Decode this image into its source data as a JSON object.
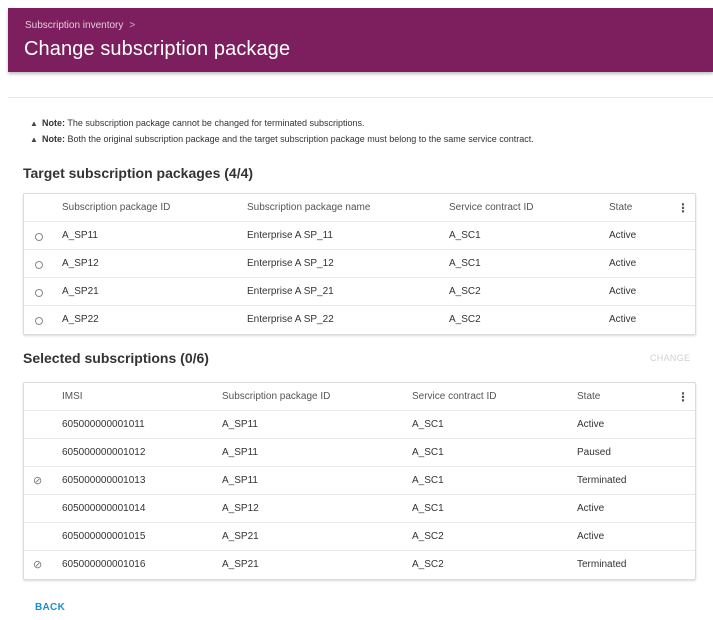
{
  "header": {
    "breadcrumb": "Subscription inventory",
    "breadcrumb_separator": ">",
    "title": "Change subscription package",
    "color": "#7d1f5e"
  },
  "notes": [
    {
      "prefix": "Note:",
      "text": "The subscription package cannot be changed for terminated subscriptions."
    },
    {
      "prefix": "Note:",
      "text": "Both the original subscription package and the target subscription package must belong to the same service contract."
    }
  ],
  "target_packages": {
    "title": "Target subscription packages (4/4)",
    "columns": [
      "Subscription package ID",
      "Subscription package name",
      "Service contract ID",
      "State"
    ],
    "rows": [
      [
        "A_SP11",
        "Enterprise A SP_11",
        "A_SC1",
        "Active"
      ],
      [
        "A_SP12",
        "Enterprise A SP_12",
        "A_SC1",
        "Active"
      ],
      [
        "A_SP21",
        "Enterprise A SP_21",
        "A_SC2",
        "Active"
      ],
      [
        "A_SP22",
        "Enterprise A SP_22",
        "A_SC2",
        "Active"
      ]
    ]
  },
  "selected_subscriptions": {
    "title": "Selected subscriptions (0/6)",
    "change_label": "CHANGE",
    "columns": [
      "IMSI",
      "Subscription package ID",
      "Service contract ID",
      "State"
    ],
    "rows": [
      [
        "605000000001011",
        "A_SP11",
        "A_SC1",
        "Active"
      ],
      [
        "605000000001012",
        "A_SP11",
        "A_SC1",
        "Paused"
      ],
      [
        "605000000001013",
        "A_SP11",
        "A_SC1",
        "Terminated"
      ],
      [
        "605000000001014",
        "A_SP12",
        "A_SC1",
        "Active"
      ],
      [
        "605000000001015",
        "A_SP21",
        "A_SC2",
        "Active"
      ],
      [
        "605000000001016",
        "A_SP21",
        "A_SC2",
        "Terminated"
      ]
    ]
  },
  "footer": {
    "back_label": "BACK"
  },
  "accent_color": "#1a8fd0"
}
